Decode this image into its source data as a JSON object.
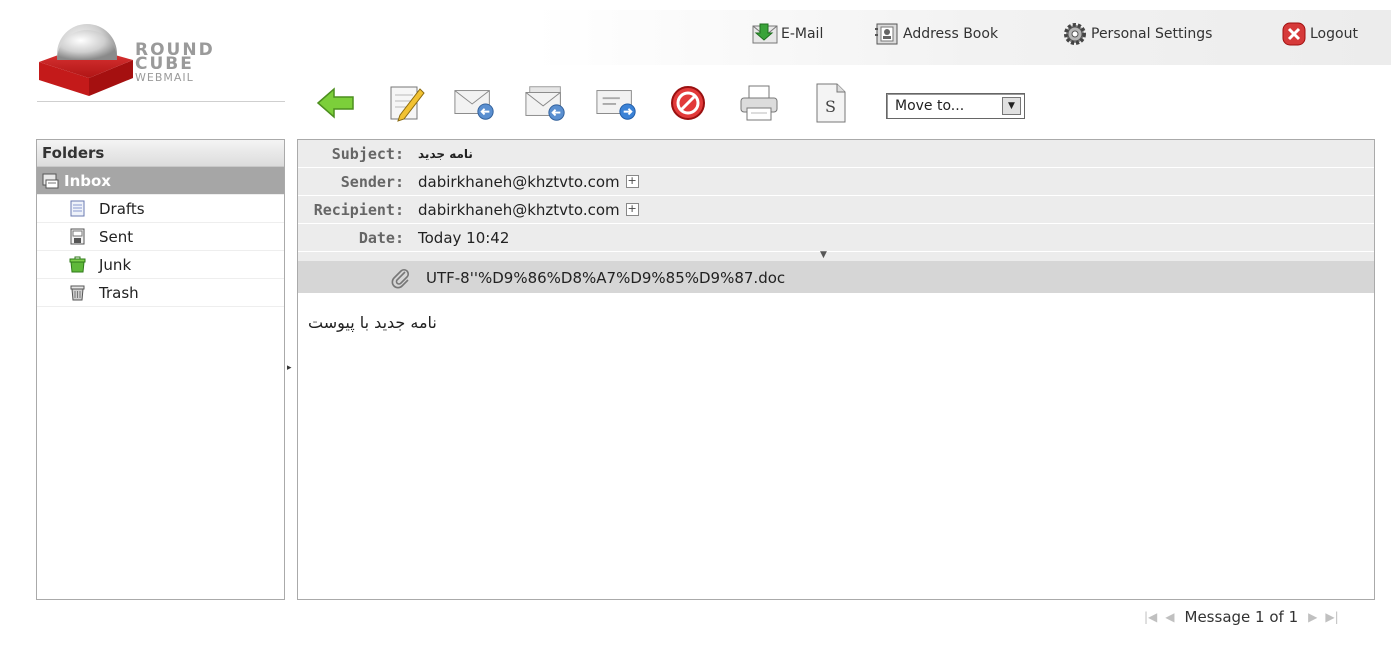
{
  "app": {
    "logo_line1": "ROUND",
    "logo_line2": "CUBE",
    "logo_line3": "WEBMAIL"
  },
  "topnav": [
    {
      "label": "E-Mail",
      "icon": "email-icon"
    },
    {
      "label": "Address Book",
      "icon": "address-book-icon"
    },
    {
      "label": "Personal Settings",
      "icon": "gear-icon"
    },
    {
      "label": "Logout",
      "icon": "logout-icon"
    }
  ],
  "toolbar": {
    "buttons": [
      "back",
      "compose",
      "reply",
      "reply-all",
      "forward",
      "delete",
      "print",
      "source"
    ],
    "move_to_label": "Move to..."
  },
  "folders": {
    "title": "Folders",
    "items": [
      {
        "label": "Inbox",
        "icon": "inbox-icon",
        "selected": true
      },
      {
        "label": "Drafts",
        "icon": "drafts-icon"
      },
      {
        "label": "Sent",
        "icon": "sent-icon"
      },
      {
        "label": "Junk",
        "icon": "junk-icon"
      },
      {
        "label": "Trash",
        "icon": "trash-icon"
      }
    ]
  },
  "message": {
    "headers": {
      "subject_label": "Subject:",
      "subject": "نامه جدید",
      "sender_label": "Sender:",
      "sender": "dabirkhaneh@khztvto.com",
      "recipient_label": "Recipient:",
      "recipient": "dabirkhaneh@khztvto.com",
      "date_label": "Date:",
      "date": "Today 10:42"
    },
    "attachment": "UTF-8''%D9%86%D8%A7%D9%85%D9%87.doc",
    "body": "نامه جدید با پیوست"
  },
  "pager": {
    "text": "Message 1 of 1"
  },
  "colors": {
    "accent": "#d22323",
    "selected_folder": "#a6a6a6",
    "header_bg": "#ececec"
  }
}
